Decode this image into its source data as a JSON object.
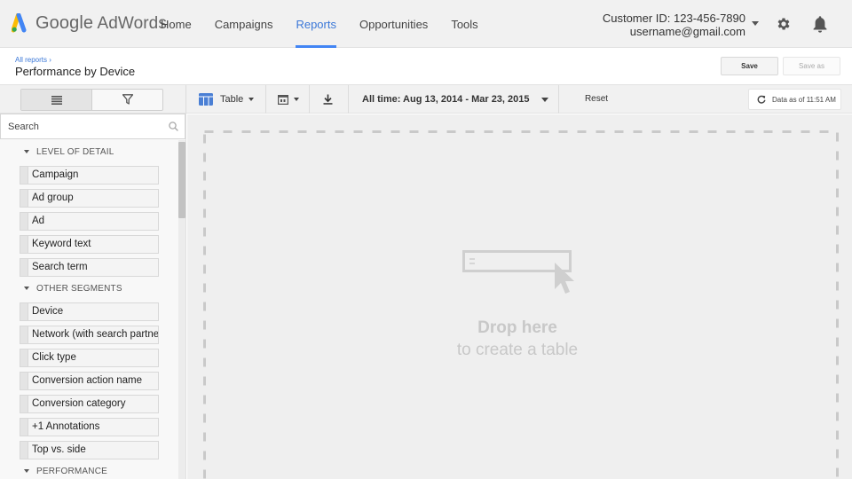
{
  "app": {
    "logo_google": "Google",
    "logo_product": "AdWords"
  },
  "nav": {
    "items": [
      {
        "label": "Home",
        "active": false
      },
      {
        "label": "Campaigns",
        "active": false
      },
      {
        "label": "Reports",
        "active": true
      },
      {
        "label": "Opportunities",
        "active": false
      },
      {
        "label": "Tools",
        "active": false
      }
    ]
  },
  "account": {
    "customer_id": "Customer ID: 123-456-7890",
    "email": "username@gmail.com"
  },
  "header": {
    "breadcrumb": "All reports ›",
    "title": "Performance by Device",
    "save_label": "Save",
    "save_as_label": "Save as"
  },
  "toolbar": {
    "view_label": "Table",
    "date_range": "All time: Aug 13, 2014 - Mar 23, 2015",
    "reset_label": "Reset",
    "data_as_of": "Data as of 11:51 AM"
  },
  "panel": {
    "search_placeholder": "Search",
    "sections": [
      {
        "title": "LEVEL OF DETAIL",
        "items": [
          "Campaign",
          "Ad group",
          "Ad",
          "Keyword text",
          "Search term"
        ]
      },
      {
        "title": "OTHER SEGMENTS",
        "items": [
          "Device",
          "Network (with search partners)",
          "Click type",
          "Conversion action name",
          "Conversion category",
          "+1 Annotations",
          "Top vs. side"
        ]
      },
      {
        "title": "PERFORMANCE",
        "items": []
      }
    ]
  },
  "canvas": {
    "drop_title": "Drop here",
    "drop_subtitle": "to create a table"
  },
  "colors": {
    "accent": "#4285f4",
    "nav_active": "#3b78d8",
    "logo_blue": "#4285f4",
    "logo_green": "#34a853",
    "logo_yellow": "#fbbc05"
  }
}
